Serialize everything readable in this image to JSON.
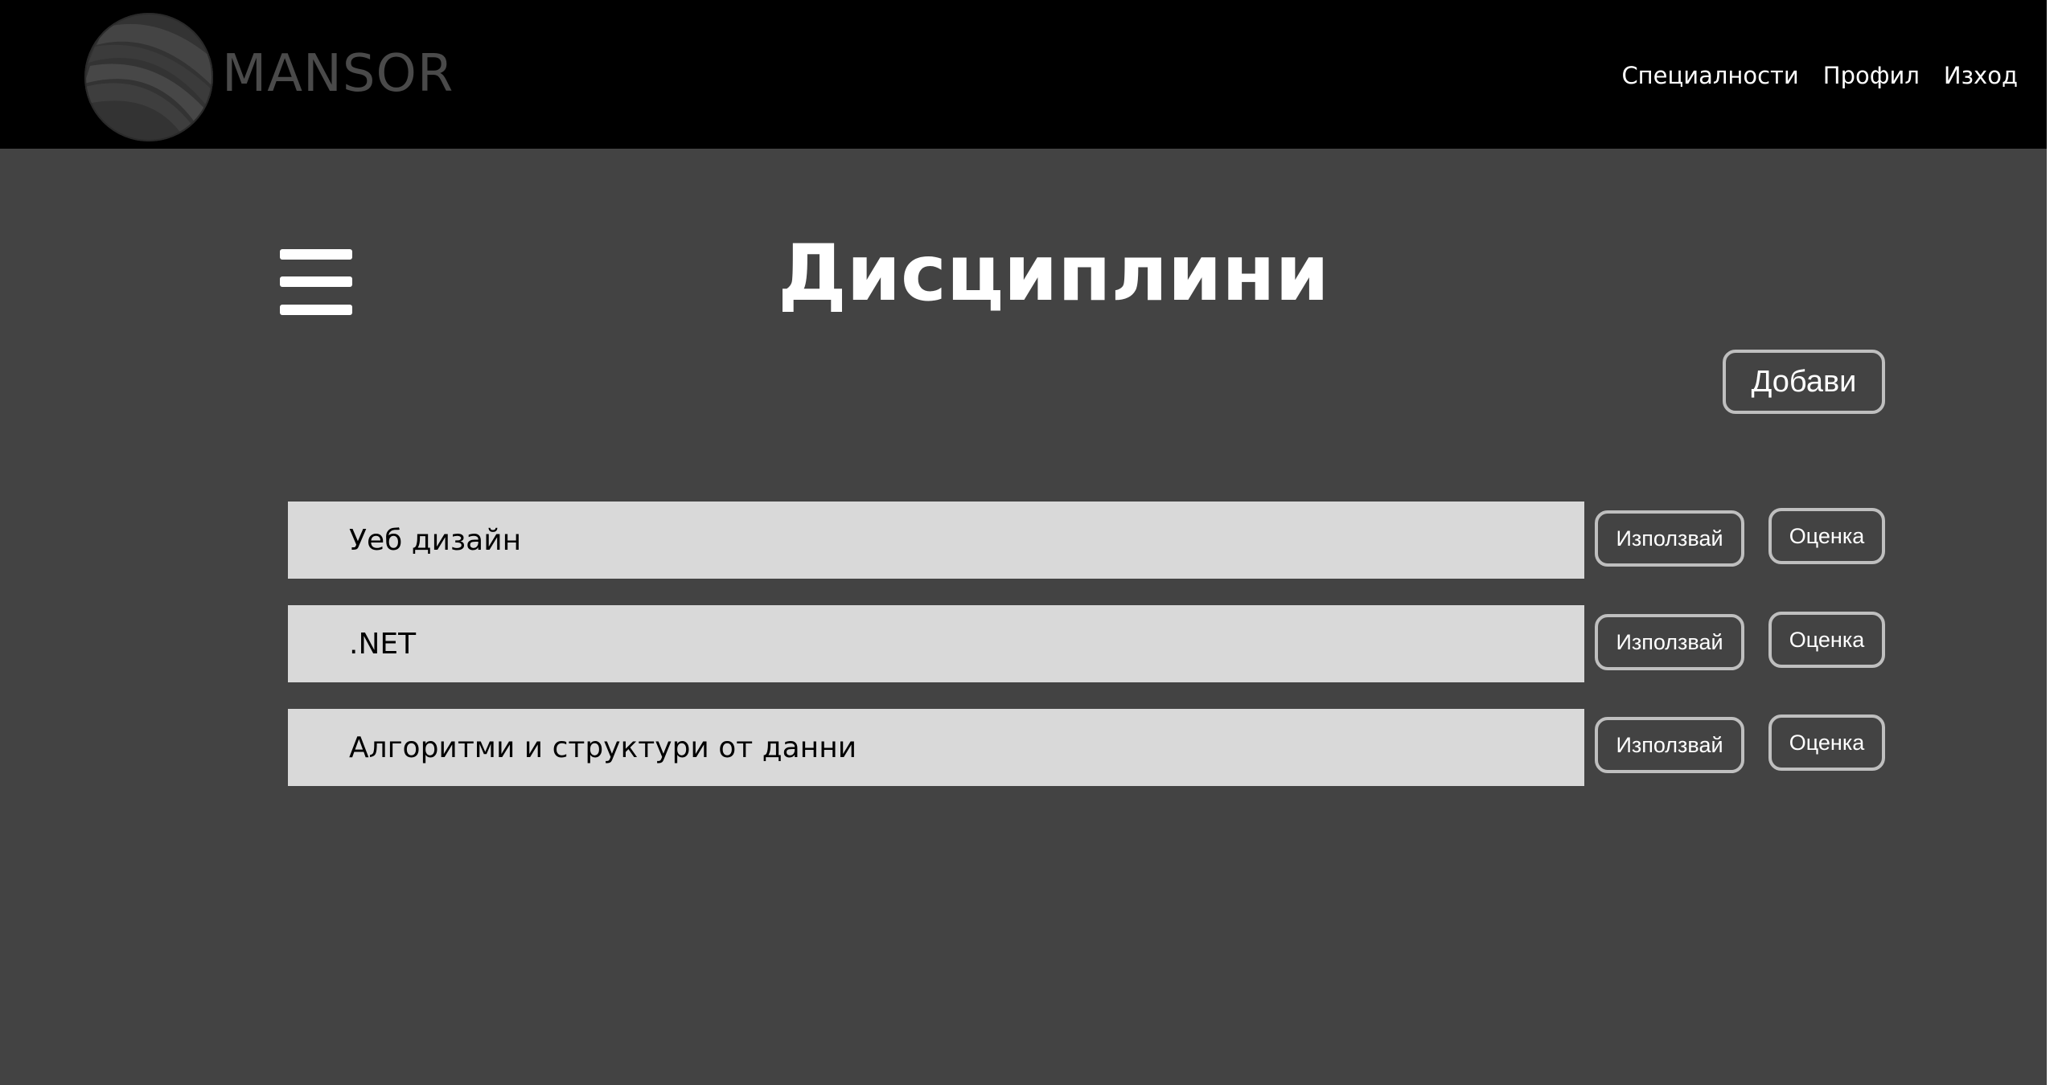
{
  "brand": {
    "name": "MANSOR"
  },
  "nav": {
    "items": [
      {
        "label": "Специалности"
      },
      {
        "label": "Профил"
      },
      {
        "label": "Изход"
      }
    ]
  },
  "main": {
    "title": "Дисциплини",
    "add_label": "Добави",
    "disciplines": [
      {
        "name": "Уеб дизайн",
        "use_label": "Използвай",
        "grade_label": "Оценка"
      },
      {
        "name": ".NET",
        "use_label": "Използвай",
        "grade_label": "Оценка"
      },
      {
        "name": "Алгоритми и структури от данни",
        "use_label": "Използвай",
        "grade_label": "Оценка"
      }
    ]
  },
  "colors": {
    "header_bg": "#000000",
    "page_bg": "#434343",
    "row_bg": "#d9d9d9",
    "button_border": "#bfbfbf",
    "logo_text": "#4a4a4a"
  },
  "icons": {
    "logo": "globe-logo-icon",
    "menu": "hamburger-menu-icon"
  }
}
